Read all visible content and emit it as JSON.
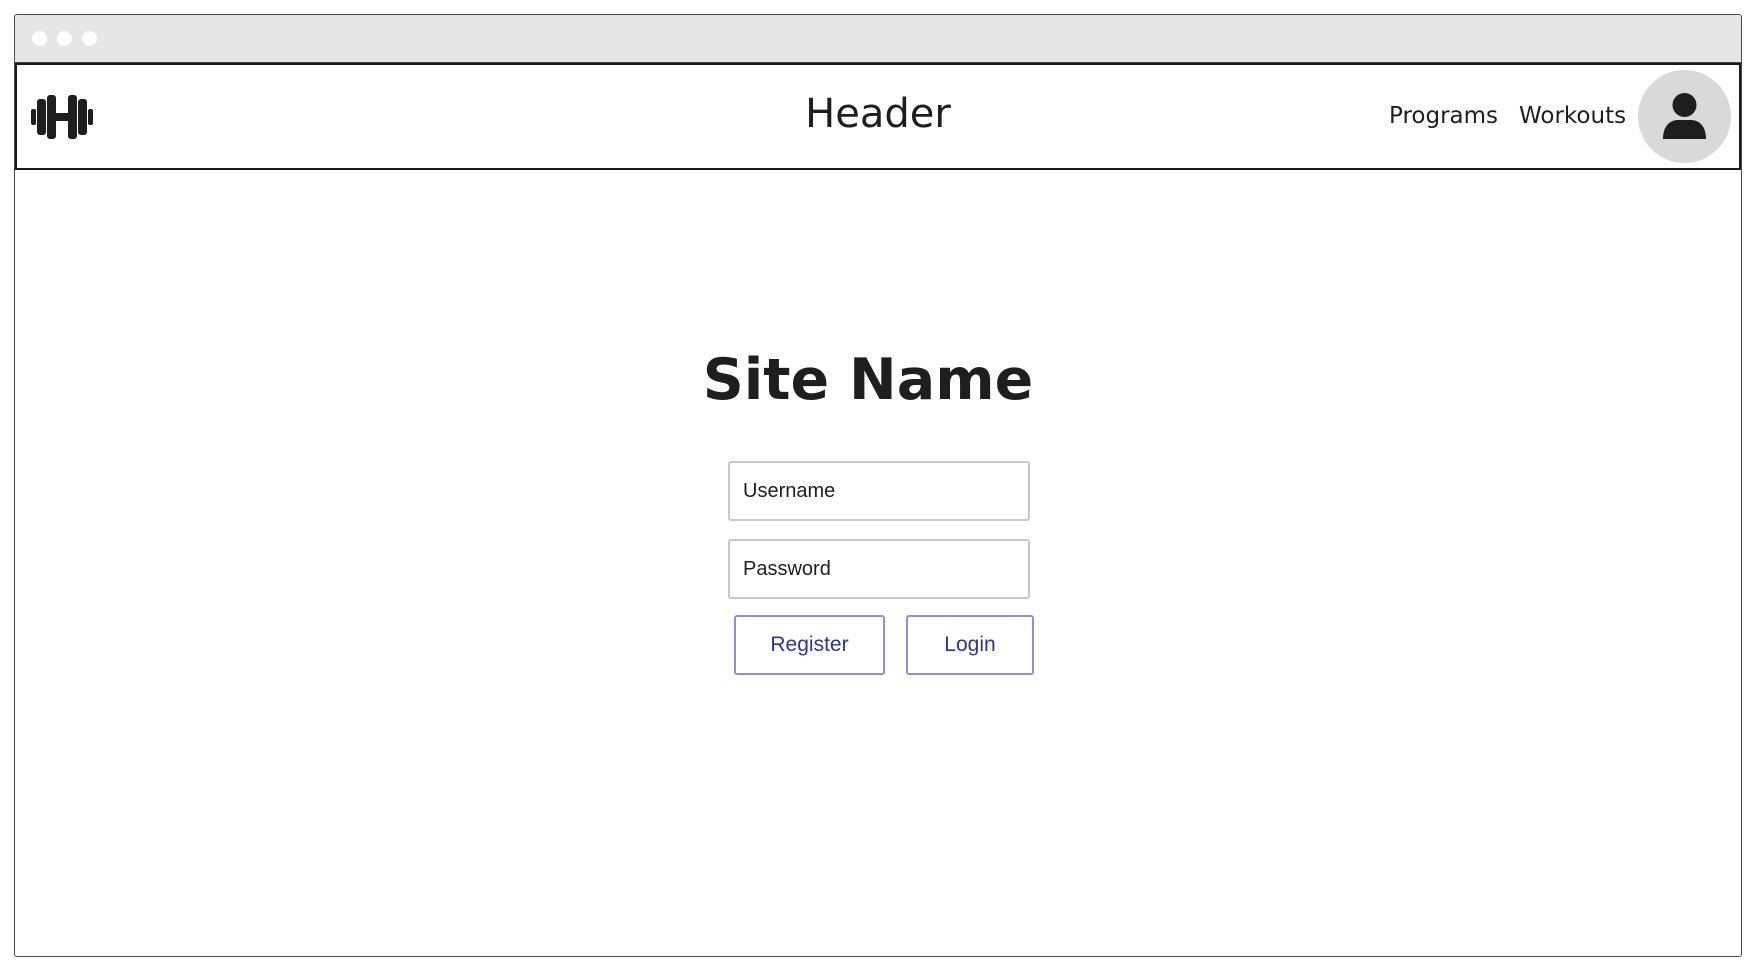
{
  "window": {
    "titlebar_controls": [
      "window-dot",
      "window-dot",
      "window-dot"
    ]
  },
  "header": {
    "logo_icon": "dumbbell-icon",
    "title": "Header",
    "nav": [
      {
        "label": "Programs"
      },
      {
        "label": "Workouts"
      }
    ],
    "avatar_icon": "user-icon"
  },
  "main": {
    "site_name": "Site Name",
    "username": {
      "placeholder": "Username",
      "value": ""
    },
    "password": {
      "placeholder": "Password",
      "value": ""
    },
    "register_label": "Register",
    "login_label": "Login"
  },
  "colors": {
    "titlebar": "#e6e6e6",
    "border": "#1a1a1a",
    "text": "#1e1e1e",
    "button_border": "#8d91d4",
    "button_text": "#2e3494",
    "avatar_bg": "#d9d9d9",
    "field_border": "#c8c8c8"
  }
}
